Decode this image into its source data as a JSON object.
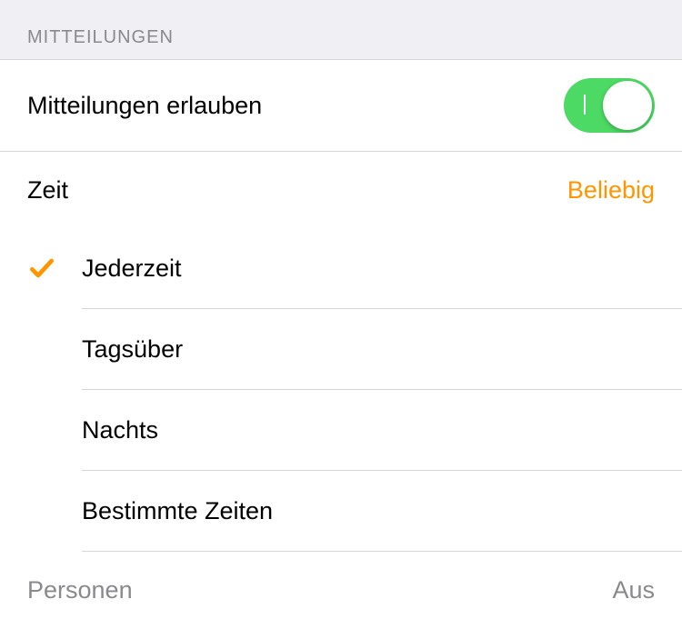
{
  "section": {
    "header": "MITTEILUNGEN"
  },
  "allow": {
    "label": "Mitteilungen erlauben",
    "on": true
  },
  "time": {
    "label": "Zeit",
    "value": "Beliebig"
  },
  "options": {
    "selected_index": 0,
    "items": [
      {
        "label": "Jederzeit"
      },
      {
        "label": "Tagsüber"
      },
      {
        "label": "Nachts"
      },
      {
        "label": "Bestimmte Zeiten"
      }
    ]
  },
  "persons": {
    "label": "Personen",
    "value": "Aus"
  },
  "colors": {
    "accent": "#ff9500",
    "toggle_on": "#4cd964"
  }
}
